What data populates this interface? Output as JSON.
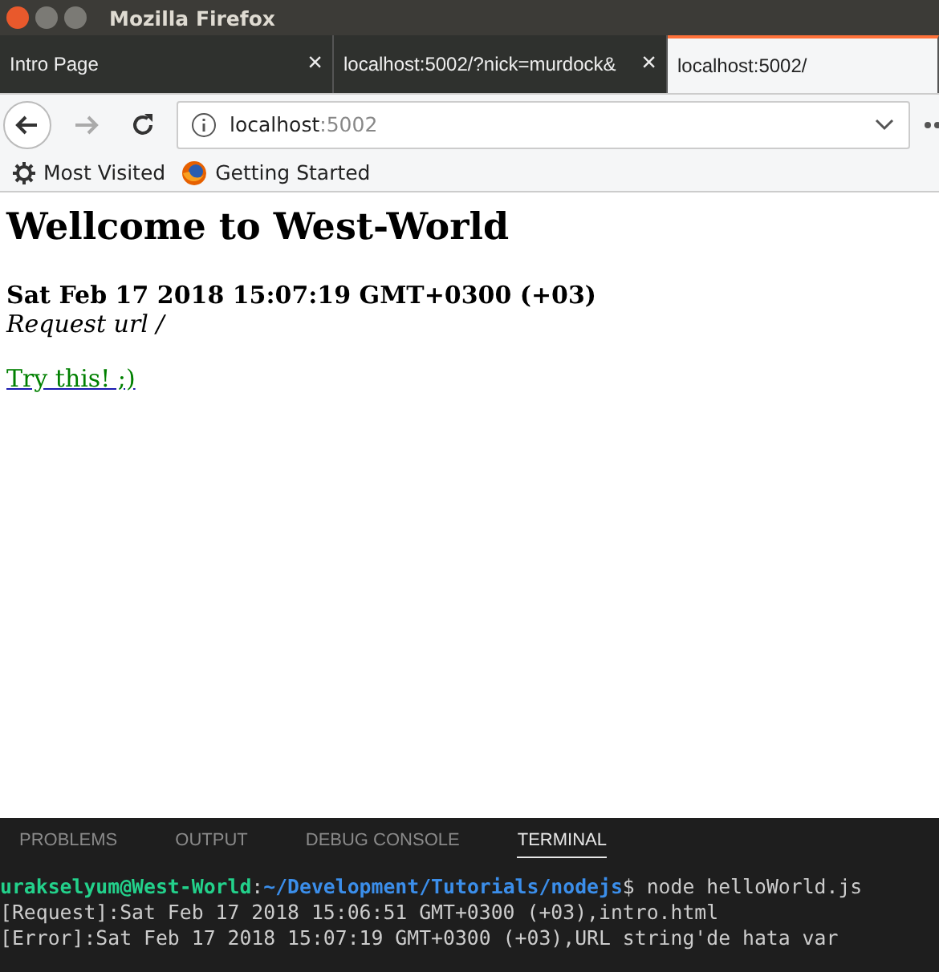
{
  "window": {
    "title": "Mozilla Firefox"
  },
  "tabs": [
    {
      "label": "Intro Page",
      "close": "×",
      "selected": false
    },
    {
      "label": "localhost:5002/?nick=murdock&",
      "close": "×",
      "selected": false
    },
    {
      "label": "localhost:5002/",
      "selected": true
    }
  ],
  "address_bar": {
    "host": "localhost",
    "port": ":5002"
  },
  "bookmarks": [
    {
      "label": "Most Visited",
      "kind": "gear"
    },
    {
      "label": "Getting Started",
      "kind": "firefox"
    }
  ],
  "page": {
    "heading": "Wellcome to West-World",
    "date": "Sat Feb 17 2018 15:07:19 GMT+0300 (+03)",
    "request": "Request url /",
    "link": "Try this! ;)"
  },
  "panel_tabs": [
    {
      "label": "PROBLEMS",
      "selected": false
    },
    {
      "label": "OUTPUT",
      "selected": false
    },
    {
      "label": "DEBUG CONSOLE",
      "selected": false
    },
    {
      "label": "TERMINAL",
      "selected": true
    }
  ],
  "terminal": {
    "user": "urakselyum@West-World",
    "separator": ":",
    "path": "~/Development/Tutorials/nodejs",
    "command": "$ node helloWorld.js",
    "lines": [
      "[Request]:Sat Feb 17 2018 15:06:51 GMT+0300 (+03),intro.html",
      "[Error]:Sat Feb 17 2018 15:07:19 GMT+0300 (+03),URL string'de hata var"
    ]
  }
}
